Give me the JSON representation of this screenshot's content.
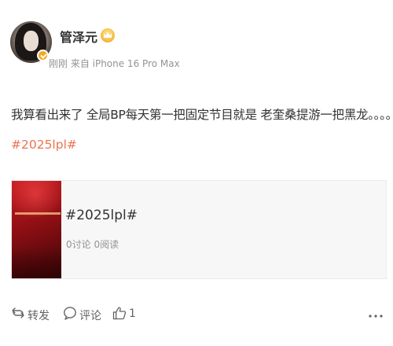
{
  "post": {
    "author": "管泽元",
    "meta": "刚刚 来自 iPhone 16 Pro Max",
    "text": "我算看出来了 全局BP每天第一把固定节目就是 老奎桑提游一把黑龙。。。。",
    "hashtag": "#2025lpl#"
  },
  "topic_card": {
    "title": "#2025lpl#",
    "stats": "0讨论 0阅读"
  },
  "actions": {
    "repost_label": "转发",
    "comment_label": "评论",
    "like_count": "1"
  },
  "colors": {
    "link": "#eb7350",
    "muted": "#939393",
    "badge": "#f5a623"
  },
  "icons": [
    "crown-icon",
    "verified-icon",
    "repost-icon",
    "comment-icon",
    "like-icon",
    "more-icon"
  ]
}
